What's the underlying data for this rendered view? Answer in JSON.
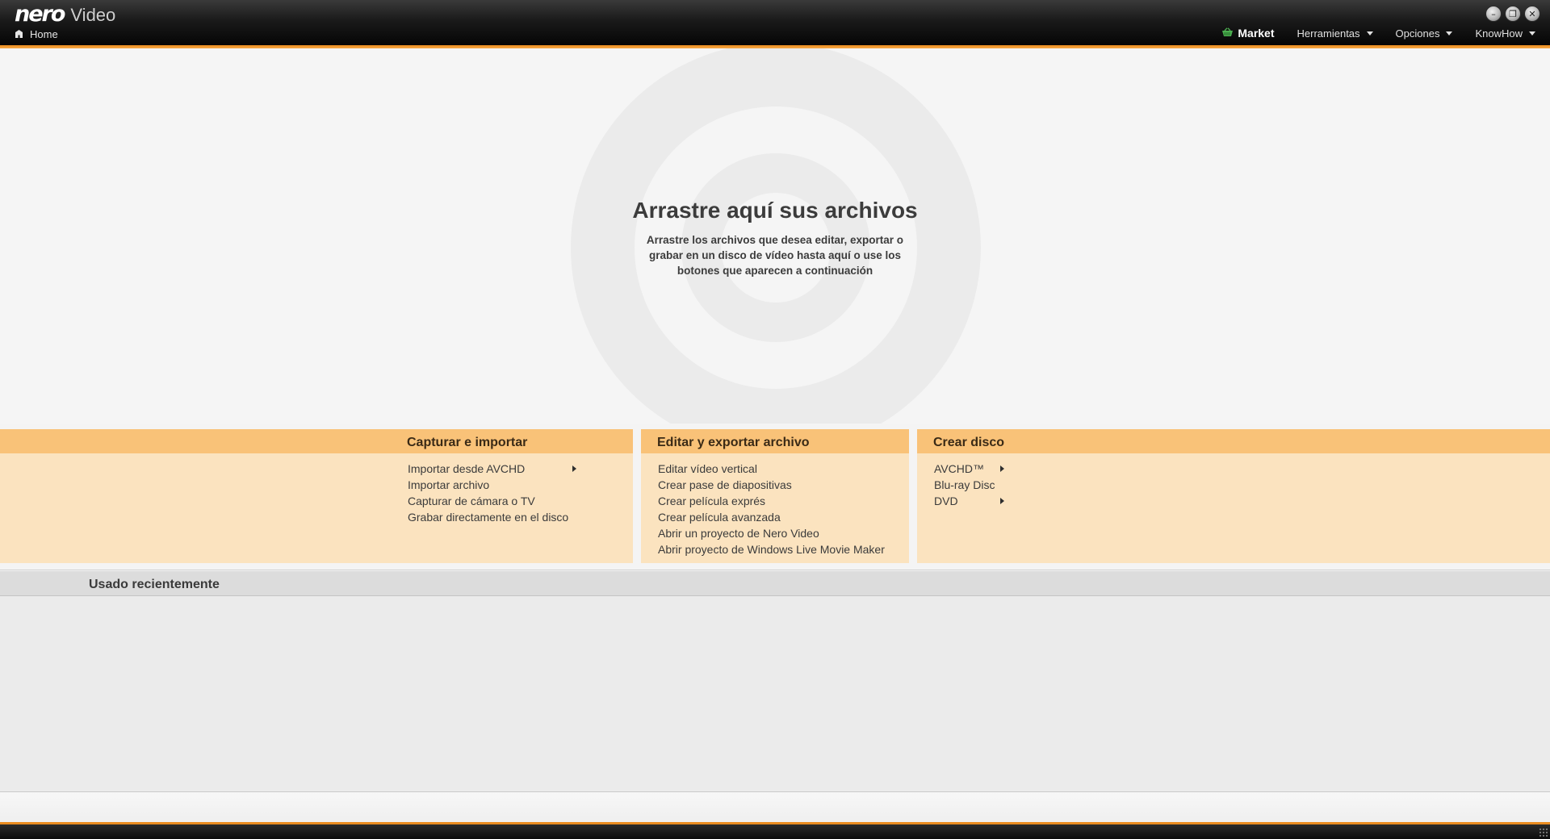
{
  "app": {
    "logo": "nero",
    "product": "Video"
  },
  "nav": {
    "home_label": "Home",
    "home_icon": "home-icon"
  },
  "window_controls": {
    "minimize_icon": "–",
    "restore_icon": "❐",
    "close_icon": "✕"
  },
  "menu": {
    "market_label": "Market",
    "tools_label": "Herramientas",
    "options_label": "Opciones",
    "knowhow_label": "KnowHow"
  },
  "dropzone": {
    "title": "Arrastre aquí sus archivos",
    "subtitle": "Arrastre los archivos que desea editar, exportar o grabar en un disco de vídeo hasta aquí o use los botones que aparecen a continuación"
  },
  "panels": {
    "capture": {
      "title": "Capturar e importar",
      "items": [
        "Importar desde AVCHD",
        "Importar archivo",
        "Capturar de cámara o TV",
        "Grabar directamente en el disco"
      ]
    },
    "edit": {
      "title": "Editar y exportar archivo",
      "items": [
        "Editar vídeo vertical",
        "Crear pase de diapositivas",
        "Crear película exprés",
        "Crear película avanzada",
        "Abrir un proyecto de Nero Video",
        "Abrir proyecto de Windows Live Movie Maker"
      ]
    },
    "disc": {
      "title": "Crear disco",
      "items": [
        "AVCHD™",
        "Blu-ray Disc",
        "DVD"
      ]
    }
  },
  "recent": {
    "title": "Usado recientemente"
  },
  "colors": {
    "accent_orange": "#e98b20",
    "panel_header": "#f9c278",
    "panel_body": "#fbe3bf",
    "market_icon": "#4caf50"
  }
}
